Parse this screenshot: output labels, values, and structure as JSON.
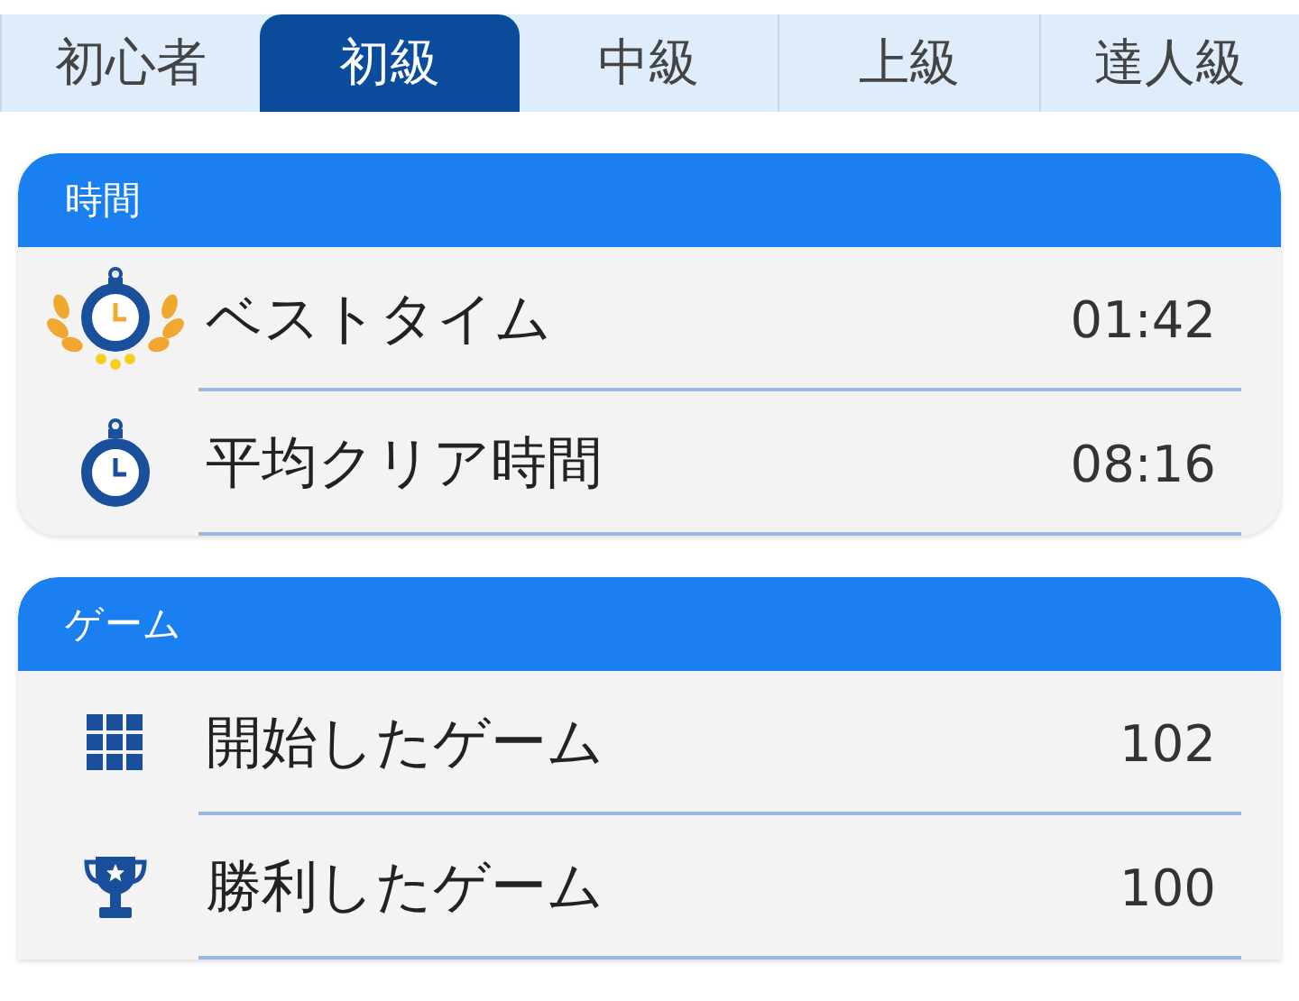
{
  "tabs": [
    {
      "label": "初心者",
      "selected": false
    },
    {
      "label": "初級",
      "selected": true
    },
    {
      "label": "中級",
      "selected": false
    },
    {
      "label": "上級",
      "selected": false
    },
    {
      "label": "達人級",
      "selected": false
    }
  ],
  "sections": [
    {
      "title": "時間",
      "rows": [
        {
          "kind": "best-time",
          "label": "ベストタイム",
          "value": "01:42"
        },
        {
          "kind": "stopwatch",
          "label": "平均クリア時間",
          "value": "08:16"
        }
      ]
    },
    {
      "title": "ゲーム",
      "rows": [
        {
          "kind": "grid",
          "label": "開始したゲーム",
          "value": "102"
        },
        {
          "kind": "trophy",
          "label": "勝利したゲーム",
          "value": "100"
        }
      ]
    }
  ]
}
